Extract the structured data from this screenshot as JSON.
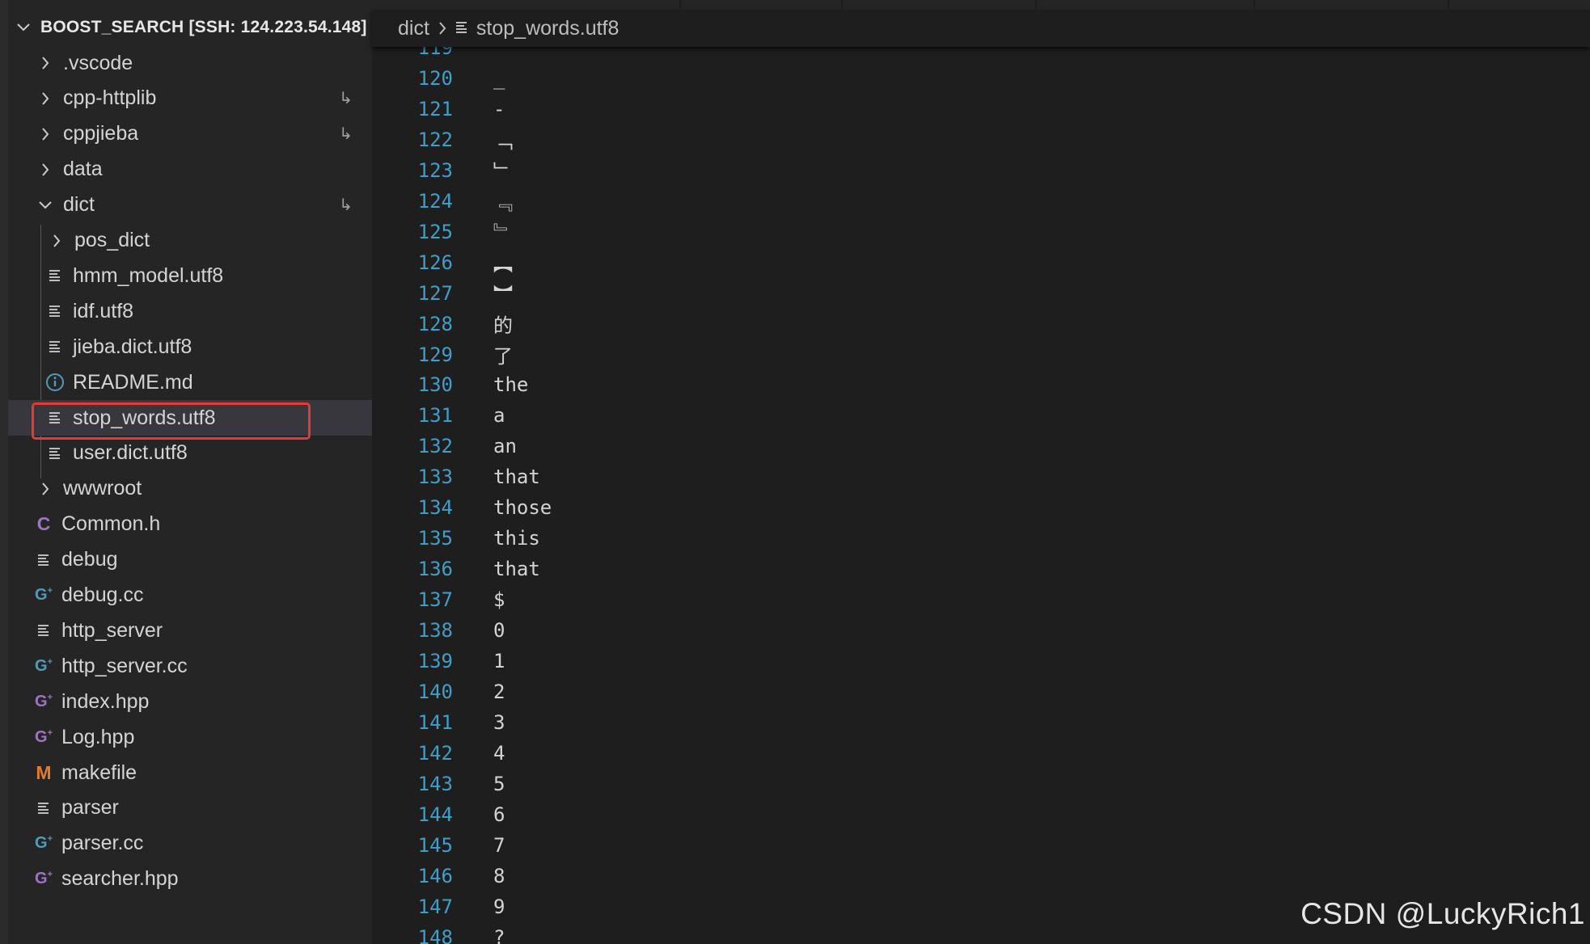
{
  "sidebar": {
    "title": "BOOST_SEARCH [SSH: 124.223.54.148]",
    "items": [
      {
        "label": ".vscode",
        "kind": "folder",
        "icon": "chevron-right-icon",
        "depth": 0,
        "link": ""
      },
      {
        "label": "cpp-httplib",
        "kind": "folder",
        "icon": "chevron-right-icon",
        "depth": 0,
        "link": "↳"
      },
      {
        "label": "cppjieba",
        "kind": "folder",
        "icon": "chevron-right-icon",
        "depth": 0,
        "link": "↳"
      },
      {
        "label": "data",
        "kind": "folder",
        "icon": "chevron-right-icon",
        "depth": 0,
        "link": ""
      },
      {
        "label": "dict",
        "kind": "folder-open",
        "icon": "chevron-down-icon",
        "depth": 0,
        "link": "↳"
      },
      {
        "label": "pos_dict",
        "kind": "folder",
        "icon": "chevron-right-icon",
        "depth": 1,
        "link": ""
      },
      {
        "label": "hmm_model.utf8",
        "kind": "file",
        "icon": "text-file-icon",
        "depth": 1,
        "link": ""
      },
      {
        "label": "idf.utf8",
        "kind": "file",
        "icon": "text-file-icon",
        "depth": 1,
        "link": ""
      },
      {
        "label": "jieba.dict.utf8",
        "kind": "file",
        "icon": "text-file-icon",
        "depth": 1,
        "link": ""
      },
      {
        "label": "README.md",
        "kind": "file",
        "icon": "info-icon",
        "depth": 1,
        "link": ""
      },
      {
        "label": "stop_words.utf8",
        "kind": "file",
        "icon": "text-file-icon",
        "depth": 1,
        "link": "",
        "selected": true
      },
      {
        "label": "user.dict.utf8",
        "kind": "file",
        "icon": "text-file-icon",
        "depth": 1,
        "link": ""
      },
      {
        "label": "wwwroot",
        "kind": "folder",
        "icon": "chevron-right-icon",
        "depth": 0,
        "link": ""
      },
      {
        "label": "Common.h",
        "kind": "file",
        "icon": "c-header-icon",
        "depth": 0,
        "link": ""
      },
      {
        "label": "debug",
        "kind": "file",
        "icon": "text-file-icon",
        "depth": 0,
        "link": ""
      },
      {
        "label": "debug.cc",
        "kind": "file",
        "icon": "cpp-file-icon",
        "depth": 0,
        "link": ""
      },
      {
        "label": "http_server",
        "kind": "file",
        "icon": "text-file-icon",
        "depth": 0,
        "link": ""
      },
      {
        "label": "http_server.cc",
        "kind": "file",
        "icon": "cpp-file-icon",
        "depth": 0,
        "link": ""
      },
      {
        "label": "index.hpp",
        "kind": "file",
        "icon": "cpp-header-icon",
        "depth": 0,
        "link": ""
      },
      {
        "label": "Log.hpp",
        "kind": "file",
        "icon": "cpp-header-icon",
        "depth": 0,
        "link": ""
      },
      {
        "label": "makefile",
        "kind": "file",
        "icon": "makefile-icon",
        "depth": 0,
        "link": ""
      },
      {
        "label": "parser",
        "kind": "file",
        "icon": "text-file-icon",
        "depth": 0,
        "link": ""
      },
      {
        "label": "parser.cc",
        "kind": "file",
        "icon": "cpp-file-icon",
        "depth": 0,
        "link": ""
      },
      {
        "label": "searcher.hpp",
        "kind": "file",
        "icon": "cpp-header-icon",
        "depth": 0,
        "link": ""
      }
    ]
  },
  "breadcrumb": {
    "folder": "dict",
    "file": "stop_words.utf8"
  },
  "editor": {
    "lines": [
      {
        "num": "119",
        "text": "︶"
      },
      {
        "num": "120",
        "text": "_"
      },
      {
        "num": "121",
        "text": "-"
      },
      {
        "num": "122",
        "text": "﹁"
      },
      {
        "num": "123",
        "text": "﹂"
      },
      {
        "num": "124",
        "text": "﹃"
      },
      {
        "num": "125",
        "text": "﹄"
      },
      {
        "num": "126",
        "text": "︻"
      },
      {
        "num": "127",
        "text": "︼"
      },
      {
        "num": "128",
        "text": "的"
      },
      {
        "num": "129",
        "text": "了"
      },
      {
        "num": "130",
        "text": "the"
      },
      {
        "num": "131",
        "text": "a"
      },
      {
        "num": "132",
        "text": "an"
      },
      {
        "num": "133",
        "text": "that"
      },
      {
        "num": "134",
        "text": "those"
      },
      {
        "num": "135",
        "text": "this"
      },
      {
        "num": "136",
        "text": "that"
      },
      {
        "num": "137",
        "text": "$"
      },
      {
        "num": "138",
        "text": "0"
      },
      {
        "num": "139",
        "text": "1"
      },
      {
        "num": "140",
        "text": "2"
      },
      {
        "num": "141",
        "text": "3"
      },
      {
        "num": "142",
        "text": "4"
      },
      {
        "num": "143",
        "text": "5"
      },
      {
        "num": "144",
        "text": "6"
      },
      {
        "num": "145",
        "text": "7"
      },
      {
        "num": "146",
        "text": "8"
      },
      {
        "num": "147",
        "text": "9"
      },
      {
        "num": "148",
        "text": "?"
      }
    ]
  },
  "watermark": "CSDN @LuckyRich1",
  "colors": {
    "line_number": "#3d9fcc",
    "highlight": "#e53935",
    "c_icon": "#a074c4",
    "cpp_icon": "#519aba",
    "makefile_icon": "#e37933",
    "info_icon": "#519aba"
  }
}
